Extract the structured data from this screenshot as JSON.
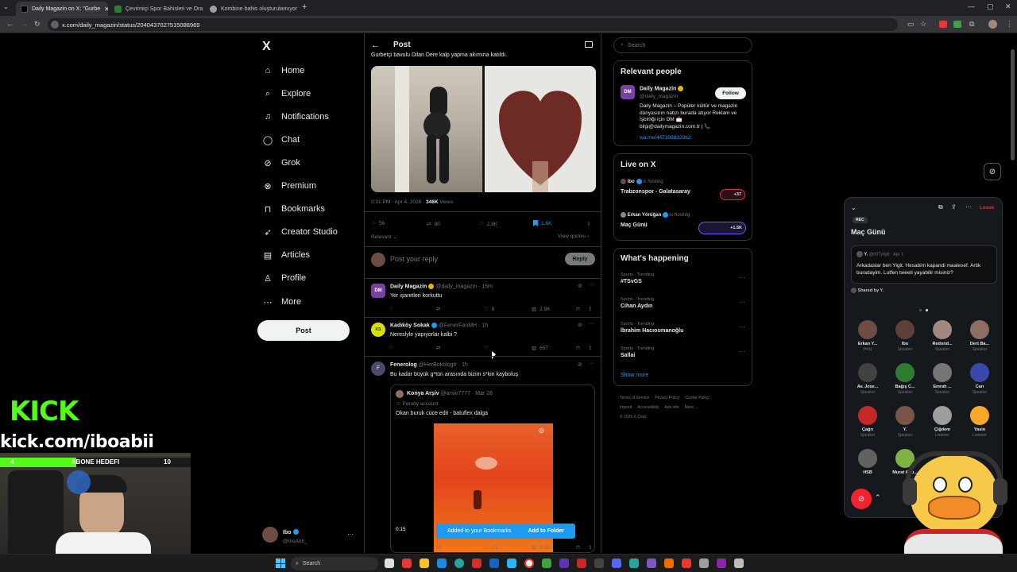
{
  "browser": {
    "tabs": [
      {
        "title": "Daily Magazin on X: \"Gurbe",
        "active": true
      },
      {
        "title": "Çevrimiçi Spor Bahisleri ve Ora",
        "active": false
      },
      {
        "title": "Kombine bahis oluşturulamıyor",
        "active": false
      }
    ],
    "url": "x.com/daily_magazin/status/2040437027515088969"
  },
  "nav": {
    "logo": "X",
    "items": [
      {
        "label": "Home",
        "icon": "home-icon"
      },
      {
        "label": "Explore",
        "icon": "search-icon"
      },
      {
        "label": "Notifications",
        "icon": "bell-icon"
      },
      {
        "label": "Chat",
        "icon": "chat-icon"
      },
      {
        "label": "Grok",
        "icon": "grok-icon"
      },
      {
        "label": "Premium",
        "icon": "premium-icon"
      },
      {
        "label": "Bookmarks",
        "icon": "bookmark-icon"
      },
      {
        "label": "Creator Studio",
        "icon": "rocket-icon"
      },
      {
        "label": "Articles",
        "icon": "articles-icon"
      },
      {
        "label": "Profile",
        "icon": "person-icon"
      },
      {
        "label": "More",
        "icon": "more-circle-icon"
      }
    ],
    "post_button": "Post",
    "account": {
      "name": "Ibo",
      "handle": "@IboAbIl_"
    }
  },
  "post": {
    "header_title": "Post",
    "text_snippet": "Gurbetçi bavulu Dilan Dere kalp yapma akımına katıldı.",
    "meta_time": "3:31 PM · Apr 4, 2026 · ",
    "meta_views": "346K",
    "meta_views_label": " Views",
    "stats": {
      "replies": "56",
      "reposts": "80",
      "likes": "2.8K",
      "bookmarks": "1.6K"
    },
    "sort_label": "Relevant",
    "view_quotes": "View quotes",
    "reply_placeholder": "Post your reply",
    "reply_button": "Reply"
  },
  "replies": [
    {
      "name": "Daily Magazin",
      "handle": "@daily_magazin",
      "time": "· 15m",
      "text": "Yer işaretleri korkuttu",
      "likes": "8",
      "views": "2.9K",
      "avatar": "DM"
    },
    {
      "name": "Kadıköy Sokak",
      "handle": "@FenerFanMH",
      "time": "· 1h",
      "text": "Nereslyle yapıyorlar kalbi ?",
      "likes": "",
      "views": "657",
      "avatar": "KS"
    },
    {
      "name": "Fenerolog",
      "handle": "@HerBokologtr",
      "time": "· 1h",
      "text": "Bu kadar büyük g*tün arasında bizim s*kin kayboluş",
      "likes": "71",
      "views": "6.2K",
      "avatar": "F"
    }
  ],
  "quote": {
    "name": "Konya Arşiv",
    "handle": "@arsiv7777",
    "time": "· Mar 28",
    "sub": "Parody account",
    "text": "Okan buruk cüce edit - batuflex dalga",
    "duration": "0:15"
  },
  "toast": {
    "message": "Added to your Bookmarks",
    "action": "Add to Folder"
  },
  "search": {
    "placeholder": "Search"
  },
  "relevant": {
    "title": "Relevant people",
    "name": "Daily Magazin",
    "handle": "@daily_magazin",
    "follow": "Follow",
    "bio": "Daily Magazin – Popüler kültür ve magazin dünyasının nabzı burada atıyor Reklam ve İşbirliği için DM 📩 bilgi@dailymagazin.com.tr | 📞",
    "link": "wa.me/447386832962"
  },
  "live": {
    "title": "Live on X",
    "items": [
      {
        "host": "Ibo",
        "status": "is hosting",
        "title": "Trabzonspor - Galatasaray",
        "count": "+37"
      },
      {
        "host": "Erkan Yörüğan",
        "status": "is hosting",
        "title": "Maç Günü",
        "count": "+1.5K"
      }
    ]
  },
  "happening": {
    "title": "What's happening",
    "trends": [
      {
        "cat": "Sports · Trending",
        "name": "#TSvGS"
      },
      {
        "cat": "Sports · Trending",
        "name": "Cihan Aydın"
      },
      {
        "cat": "Sports · Trending",
        "name": "İbrahim Hacıosmanoğlu"
      },
      {
        "cat": "Sports · Trending",
        "name": "Sallai"
      }
    ],
    "show_more": "Show more"
  },
  "footer": [
    "Terms of Service",
    "Privacy Policy",
    "Cookie Policy",
    "Imprint",
    "Accessibility",
    "Ads info",
    "More ...",
    "© 2026 X Corp."
  ],
  "space": {
    "rec": "REC",
    "title": "Maç Günü",
    "leave": "Leave",
    "pinned": {
      "user": "Y.",
      "handle": "@007yilgit · Apr 1",
      "text": "Arkadaslar ben Yigit. Hesabim kapandi maalesef. Artik buradayim. Lutfen tweeti yayabilir misiniz?"
    },
    "shared_by": "Shared by Y.",
    "speakers": [
      {
        "name": "Erkan Y...",
        "role": "Host"
      },
      {
        "name": "Ibo",
        "role": "Speaker"
      },
      {
        "name": "Redond...",
        "role": "Speaker"
      },
      {
        "name": "Dert Ba...",
        "role": "Speaker"
      },
      {
        "name": "Av. Jose...",
        "role": "Speaker"
      },
      {
        "name": "Bağış C...",
        "role": "Speaker"
      },
      {
        "name": "Emrah ...",
        "role": "Speaker"
      },
      {
        "name": "Can",
        "role": "Speaker"
      },
      {
        "name": "Çağrı",
        "role": "Speaker"
      },
      {
        "name": "Y.",
        "role": "Speaker"
      },
      {
        "name": "Çiğdem",
        "role": "Listener"
      },
      {
        "name": "Yasin",
        "role": "Listener"
      },
      {
        "name": "HSB",
        "role": ""
      },
      {
        "name": "Murat Altu...",
        "role": ""
      }
    ]
  },
  "stream": {
    "kick_logo": "KICK",
    "kick_url": "kick.com/iboabii",
    "goal_current": "4",
    "goal_label": "ABONE HEDEFI",
    "goal_target": "10",
    "goal_progress": 0.4
  },
  "taskbar": {
    "search": "Search"
  }
}
